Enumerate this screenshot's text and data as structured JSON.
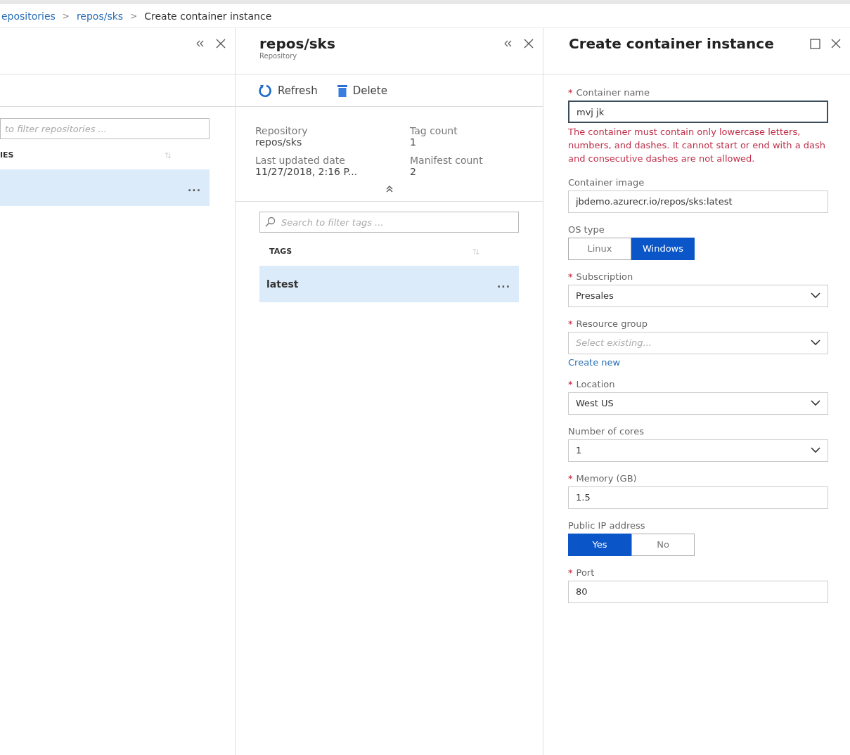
{
  "breadcrumb": [
    {
      "label": "epositories"
    },
    {
      "label": "repos/sks"
    },
    {
      "label": "Create container instance"
    }
  ],
  "breadcrumb_separator": ">",
  "left_panel": {
    "filter": {
      "placeholder": "to filter repositories ..."
    },
    "column_header": "IES",
    "rows": [
      {
        "selected": true,
        "more": "..."
      }
    ]
  },
  "middle_panel": {
    "title": "repos/sks",
    "subtitle": "Repository",
    "toolbar": [
      {
        "kind": "refresh",
        "label": "Refresh"
      },
      {
        "kind": "delete",
        "label": "Delete"
      }
    ],
    "info": [
      {
        "label": "Repository",
        "value": "repos/sks"
      },
      {
        "label": "Tag count",
        "value": "1"
      },
      {
        "label": "Last updated date",
        "value": "11/27/2018, 2:16 P..."
      },
      {
        "label": "Manifest count",
        "value": "2"
      }
    ],
    "search": {
      "placeholder": "Search to filter tags ..."
    },
    "column_header": "TAGS",
    "rows": [
      {
        "name": "latest",
        "selected": true,
        "more": "..."
      }
    ]
  },
  "right_panel": {
    "title": "Create container instance",
    "required_mark": "*",
    "fields": [
      {
        "kind": "text",
        "label": "Container name",
        "required": true,
        "value": "mvj jk",
        "focused": true,
        "error": "The container must contain only lowercase letters, numbers, and dashes. It cannot start or end with a dash and consecutive dashes are not allowed."
      },
      {
        "kind": "text",
        "label": "Container image",
        "required": false,
        "value": "jbdemo.azurecr.io/repos/sks:latest"
      },
      {
        "kind": "toggle",
        "label": "OS type",
        "required": false,
        "options": [
          {
            "label": "Linux",
            "selected": false
          },
          {
            "label": "Windows",
            "selected": true
          }
        ]
      },
      {
        "kind": "select",
        "label": "Subscription",
        "required": true,
        "value": "Presales"
      },
      {
        "kind": "select",
        "label": "Resource group",
        "required": true,
        "placeholder": "Select existing...",
        "link": "Create new"
      },
      {
        "kind": "select",
        "label": "Location",
        "required": true,
        "value": "West US"
      },
      {
        "kind": "select",
        "label": "Number of cores",
        "required": false,
        "value": "1"
      },
      {
        "kind": "text",
        "label": "Memory (GB)",
        "required": true,
        "value": "1.5"
      },
      {
        "kind": "toggle",
        "label": "Public IP address",
        "required": false,
        "options": [
          {
            "label": "Yes",
            "selected": true
          },
          {
            "label": "No",
            "selected": false
          }
        ]
      },
      {
        "kind": "text",
        "label": "Port",
        "required": true,
        "value": "80"
      }
    ]
  }
}
